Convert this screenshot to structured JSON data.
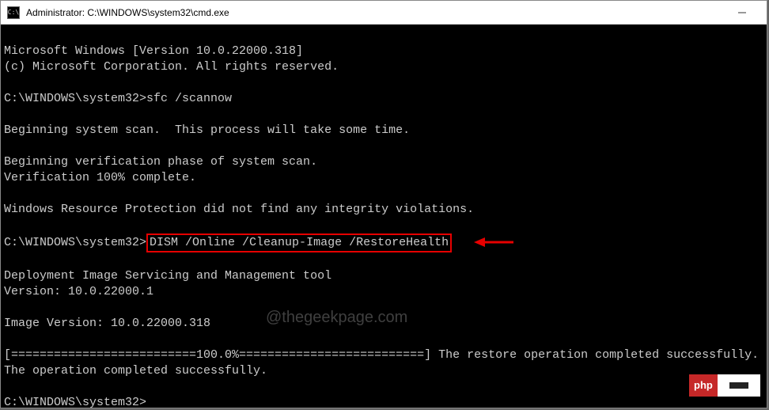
{
  "titlebar": {
    "icon_text": "C:\\",
    "title": "Administrator: C:\\WINDOWS\\system32\\cmd.exe"
  },
  "terminal": {
    "line1": "Microsoft Windows [Version 10.0.22000.318]",
    "line2": "(c) Microsoft Corporation. All rights reserved.",
    "blank1": "",
    "prompt1_path": "C:\\WINDOWS\\system32>",
    "prompt1_cmd": "sfc /scannow",
    "blank2": "",
    "scan1": "Beginning system scan.  This process will take some time.",
    "blank3": "",
    "verify1": "Beginning verification phase of system scan.",
    "verify2": "Verification 100% complete.",
    "blank4": "",
    "wrp": "Windows Resource Protection did not find any integrity violations.",
    "blank5": "",
    "prompt2_path": "C:\\WINDOWS\\system32>",
    "prompt2_cmd": "DISM /Online /Cleanup-Image /RestoreHealth",
    "blank6": "",
    "dism1": "Deployment Image Servicing and Management tool",
    "dism2": "Version: 10.0.22000.1",
    "blank7": "",
    "imgver": "Image Version: 10.0.22000.318",
    "blank8": "",
    "progress": "[==========================100.0%==========================] The restore operation completed successfully.",
    "opdone": "The operation completed successfully.",
    "blank9": "",
    "prompt3": "C:\\WINDOWS\\system32>"
  },
  "watermark": "@thegeekpage.com",
  "badge": {
    "label": "php"
  }
}
